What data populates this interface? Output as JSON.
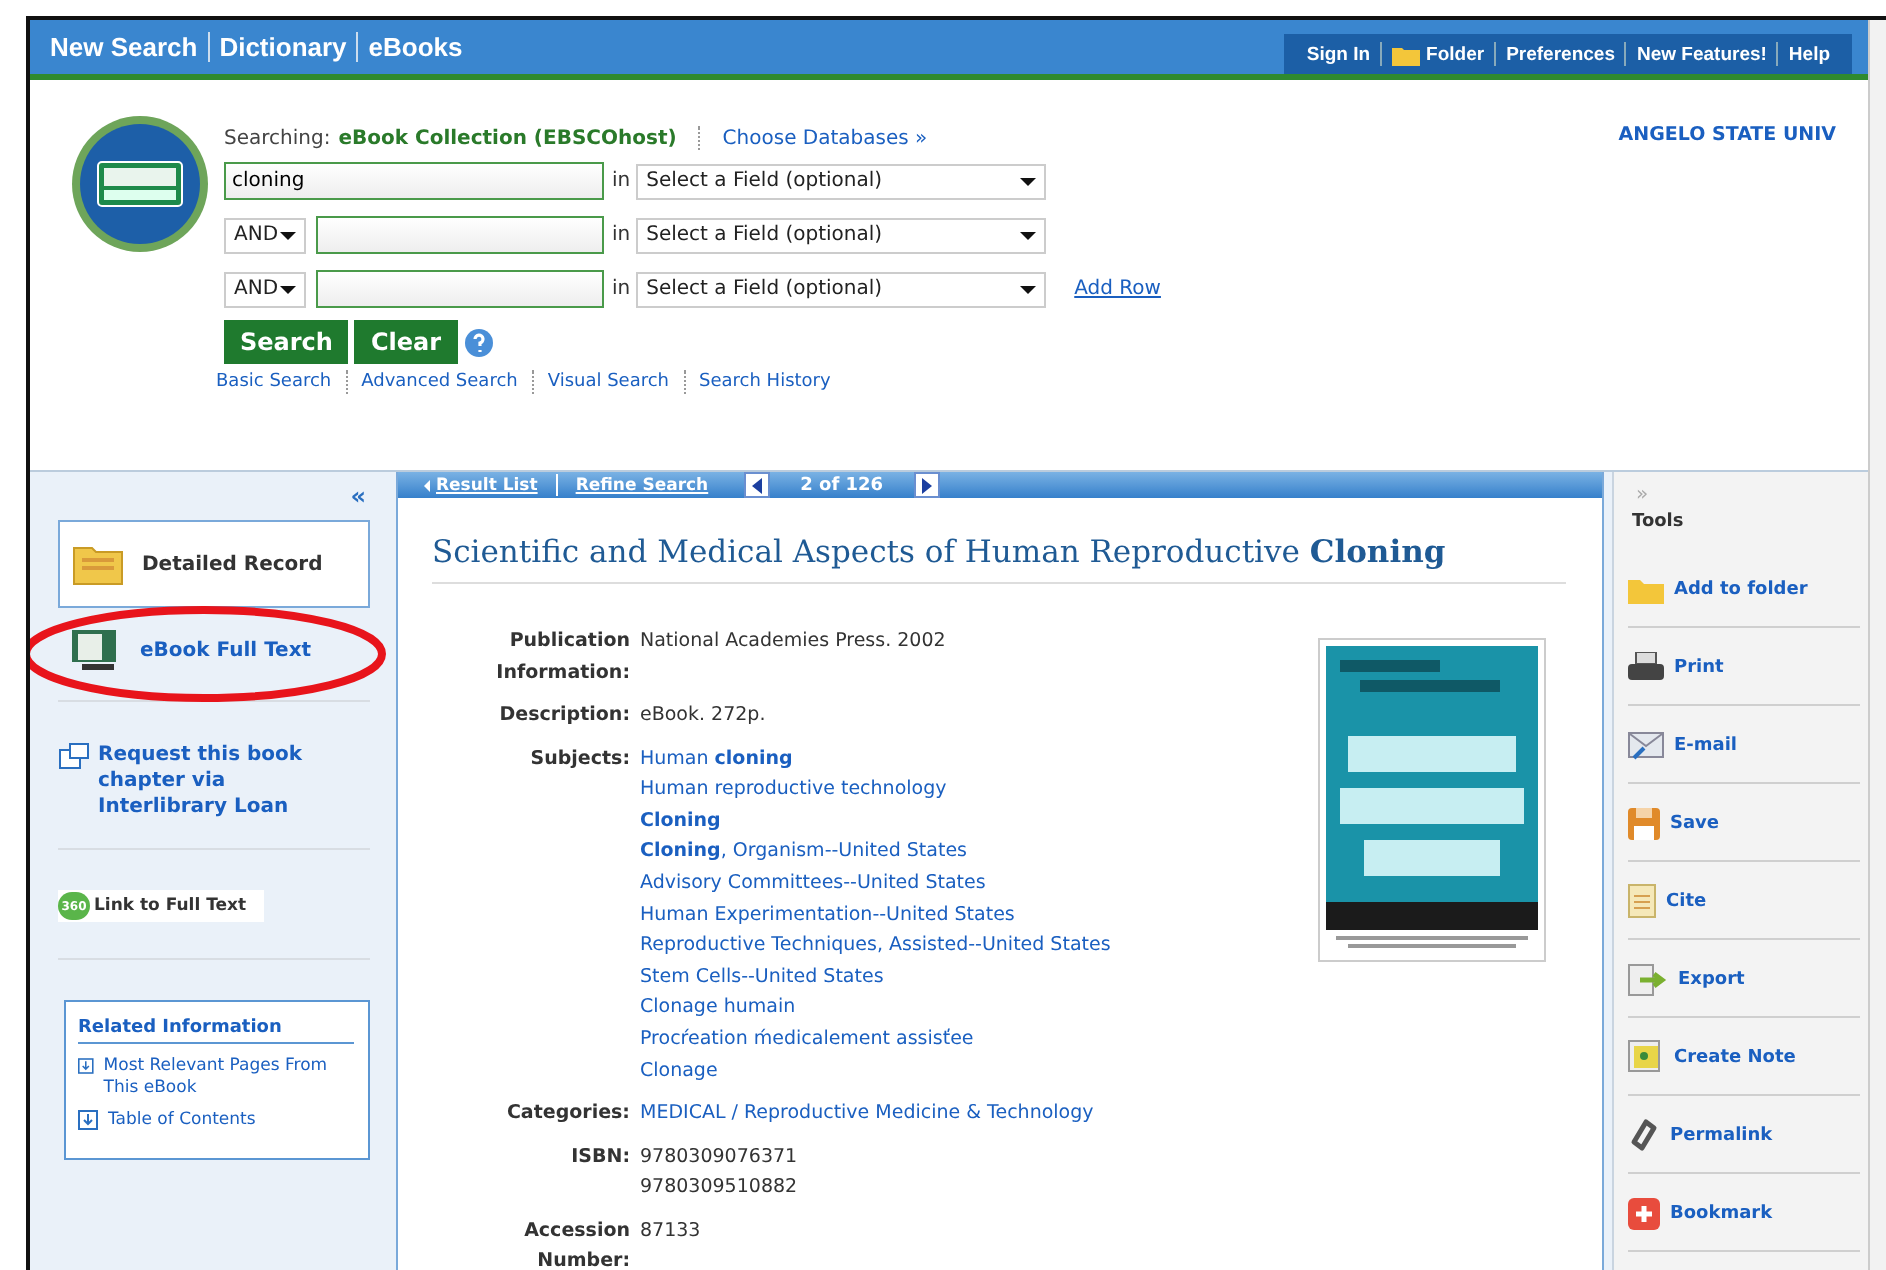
{
  "top_nav": [
    {
      "label": "New Search"
    },
    {
      "label": "Dictionary"
    },
    {
      "label": "eBooks"
    }
  ],
  "user_menu": [
    {
      "label": "Sign In",
      "kind": "text"
    },
    {
      "label": "Folder",
      "kind": "folder"
    },
    {
      "label": "Preferences",
      "kind": "text"
    },
    {
      "label": "New Features!",
      "kind": "text"
    },
    {
      "label": "Help",
      "kind": "text"
    }
  ],
  "institution": "ANGELO STATE UNIV",
  "search": {
    "searching_label": "Searching:",
    "database": "eBook Collection (EBSCOhost)",
    "choose_databases": "Choose Databases »",
    "rows": [
      {
        "value": "cloning",
        "in_label": "in",
        "field": "Select a Field (optional)"
      },
      {
        "operator": "AND",
        "in_label": "in",
        "field": "Select a Field (optional)"
      },
      {
        "operator": "AND",
        "in_label": "in",
        "field": "Select a Field (optional)"
      }
    ],
    "add_row": "Add Row",
    "buttons": [
      "Search",
      "Clear"
    ],
    "links": [
      "Basic Search",
      "Advanced Search",
      "Visual Search",
      "Search History"
    ]
  },
  "left_panel": {
    "collapse": "«",
    "items": [
      {
        "label": "Detailed Record",
        "kind": "detailed",
        "selected": true
      },
      {
        "label": "eBook Full Text",
        "kind": "ebook",
        "selected": false
      }
    ],
    "highlight": true,
    "request_link": "Request this book chapter via Interlibrary Loan",
    "full_text_link": {
      "badge": "360",
      "label": "Link to Full Text"
    },
    "related": {
      "title": "Related Information",
      "links": [
        "Most Relevant Pages From This eBook",
        "Table of Contents"
      ]
    }
  },
  "record": {
    "nav": {
      "result_list": "Result List",
      "refine_search": "Refine Search",
      "position": "2 of 126"
    },
    "title": "Scientific and Medical Aspects of Human Reproductive **Cloning**",
    "fields": [
      {
        "label": "Publication Information:",
        "kind": "text",
        "values": [
          {
            "text": "National Academies Press. 2002"
          }
        ]
      },
      {
        "label": "Description:",
        "kind": "text",
        "values": [
          {
            "text": "eBook. 272p."
          }
        ]
      },
      {
        "label": "Subjects:",
        "kind": "link",
        "values": [
          {
            "text": "Human **cloning**"
          },
          {
            "text": "Human reproductive technology"
          },
          {
            "text": "Cloning",
            "bold": true
          },
          {
            "text": "**Cloning**, Organism--United States"
          },
          {
            "text": "Advisory Committees--United States"
          },
          {
            "text": "Human Experimentation--United States"
          },
          {
            "text": "Reproductive Techniques, Assisted--United States"
          },
          {
            "text": "Stem Cells--United States"
          },
          {
            "text": "Clonage humain"
          },
          {
            "text": "Procŕeation ḿedicalement assisťee"
          },
          {
            "text": "Clonage"
          }
        ]
      },
      {
        "label": "Categories:",
        "kind": "link",
        "values": [
          {
            "text": "MEDICAL / Reproductive Medicine & Technology"
          }
        ]
      },
      {
        "label": "ISBN:",
        "kind": "text",
        "values": [
          {
            "text": "9780309076371"
          },
          {
            "text": "9780309510882"
          }
        ]
      },
      {
        "label": "Accession Number:",
        "kind": "text",
        "values": [
          {
            "text": "87133"
          }
        ]
      }
    ]
  },
  "tools": {
    "expand": "»",
    "title": "Tools",
    "items": [
      {
        "label": "Add to folder",
        "kind": "folder"
      },
      {
        "label": "Print",
        "kind": "print"
      },
      {
        "label": "E-mail",
        "kind": "email"
      },
      {
        "label": "Save",
        "kind": "save"
      },
      {
        "label": "Cite",
        "kind": "cite"
      },
      {
        "label": "Export",
        "kind": "export"
      },
      {
        "label": "Create Note",
        "kind": "note"
      },
      {
        "label": "Permalink",
        "kind": "link"
      },
      {
        "label": "Bookmark",
        "kind": "bookmark"
      }
    ]
  }
}
